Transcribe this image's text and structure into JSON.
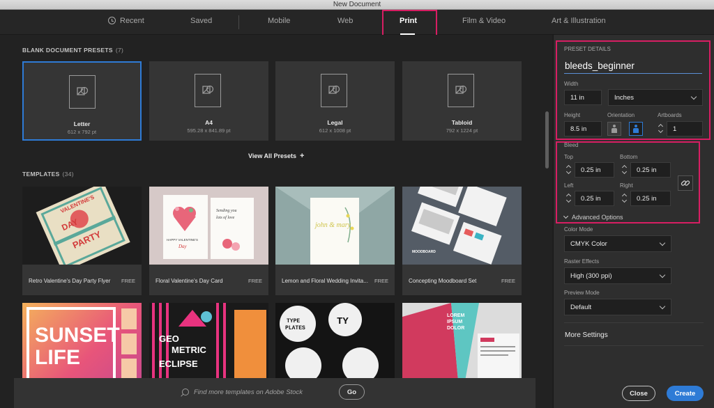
{
  "window": {
    "title": "New Document"
  },
  "tabs": [
    {
      "label": "Recent",
      "icon": "clock-icon"
    },
    {
      "label": "Saved"
    },
    {
      "label": "Mobile"
    },
    {
      "label": "Web"
    },
    {
      "label": "Print",
      "active": true
    },
    {
      "label": "Film & Video"
    },
    {
      "label": "Art & Illustration"
    }
  ],
  "blank_presets": {
    "heading": "BLANK DOCUMENT PRESETS",
    "count": "(7)",
    "items": [
      {
        "name": "Letter",
        "size": "612 x 792 pt",
        "selected": true
      },
      {
        "name": "A4",
        "size": "595.28 x 841.89 pt"
      },
      {
        "name": "Legal",
        "size": "612 x 1008 pt"
      },
      {
        "name": "Tabloid",
        "size": "792 x 1224 pt"
      }
    ],
    "view_all_label": "View All Presets"
  },
  "templates": {
    "heading": "TEMPLATES",
    "count": "(34)",
    "items": [
      {
        "name": "Retro Valentine's Day Party Flyer",
        "badge": "FREE"
      },
      {
        "name": "Floral Valentine's Day Card",
        "badge": "FREE"
      },
      {
        "name": "Lemon and Floral Wedding Invita...",
        "badge": "FREE"
      },
      {
        "name": "Concepting Moodboard Set",
        "badge": "FREE"
      },
      {
        "name": "",
        "badge": ""
      },
      {
        "name": "",
        "badge": ""
      },
      {
        "name": "",
        "badge": ""
      },
      {
        "name": "",
        "badge": ""
      }
    ],
    "thumb_text": {
      "valentine_1": "VALENTINE'S",
      "valentine_2": "DAY",
      "valentine_3": "PARTY",
      "card_1": "HAPPY VALENTINE'S",
      "card_2": "Day",
      "card_3": "Sending you",
      "card_4": "lots of love",
      "wedding": "john & mary",
      "moodboard": "MOODBOARD",
      "sunset_1": "SUNSET",
      "sunset_2": "LIFE",
      "geo_1": "GEO",
      "geo_2": "METRIC",
      "geo_3": "ECLIPSE",
      "type_1": "TYPE",
      "type_2": "PLATES",
      "type_3": "TY",
      "dirty_1": "LOREM",
      "dirty_2": "IPSUM",
      "dirty_3": "DOLOR"
    }
  },
  "search": {
    "placeholder": "Find more templates on Adobe Stock",
    "go_label": "Go"
  },
  "preset_details": {
    "heading": "PRESET DETAILS",
    "name": "bleeds_beginner",
    "width_label": "Width",
    "width": "11 in",
    "units": "Inches",
    "height_label": "Height",
    "height": "8.5 in",
    "orientation_label": "Orientation",
    "artboards_label": "Artboards",
    "artboards": "1",
    "bleed_label": "Bleed",
    "top_label": "Top",
    "top": "0.25 in",
    "bottom_label": "Bottom",
    "bottom": "0.25 in",
    "left_label": "Left",
    "left": "0.25 in",
    "right_label": "Right",
    "right": "0.25 in",
    "advanced_label": "Advanced Options",
    "color_mode_label": "Color Mode",
    "color_mode": "CMYK Color",
    "raster_label": "Raster Effects",
    "raster": "High (300 ppi)",
    "preview_label": "Preview Mode",
    "preview": "Default",
    "more_settings": "More Settings",
    "close_label": "Close",
    "create_label": "Create"
  },
  "colors": {
    "accent": "#2e7bd6",
    "highlight": "#d81e63",
    "panel": "#2e2e2e",
    "background": "#222222"
  }
}
